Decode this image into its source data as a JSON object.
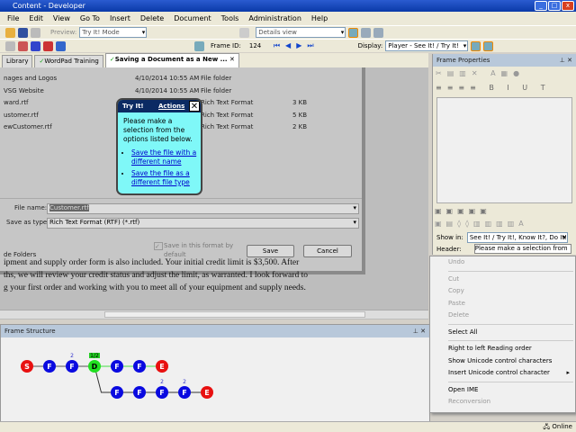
{
  "window": {
    "title": "Content - Developer"
  },
  "menu": [
    "File",
    "Edit",
    "View",
    "Go To",
    "Insert",
    "Delete",
    "Document",
    "Tools",
    "Administration",
    "Help"
  ],
  "toolbar": {
    "preview_label": "Preview:",
    "preview_mode": "Try It! Mode",
    "view_select": "Details view",
    "frame_id_label": "Frame ID:",
    "frame_id": "124",
    "display_label": "Display:",
    "display_value": "Player - See It! / Try It!"
  },
  "tabs": [
    {
      "label": "Library"
    },
    {
      "label": "WordPad Training"
    },
    {
      "label": "Saving a Document as a New ..."
    }
  ],
  "dialog": {
    "files": [
      {
        "name": "nages and Logos",
        "date": "4/10/2014 10:55 AM",
        "type": "File folder",
        "size": ""
      },
      {
        "name": "VSG Website",
        "date": "4/10/2014 10:55 AM",
        "type": "File folder",
        "size": ""
      },
      {
        "name": "ward.rtf",
        "date": "",
        "type": "Rich Text Format",
        "size": "3 KB"
      },
      {
        "name": "ustomer.rtf",
        "date": "",
        "type": "Rich Text Format",
        "size": "5 KB"
      },
      {
        "name": "ewCustomer.rtf",
        "date": "",
        "type": "Rich Text Format",
        "size": "2 KB"
      }
    ],
    "file_name_label": "File name:",
    "file_name": "Customer.rtf",
    "save_type_label": "Save as type:",
    "save_type": "Rich Text Format (RTF) (*.rtf)",
    "checkbox_label": "Save in this format by default",
    "hide_folders": "de Folders",
    "save": "Save",
    "cancel": "Cancel"
  },
  "tryit": {
    "title": "Try It!",
    "actions": "Actions",
    "body": "Please make a selection from the options listed below.",
    "options": [
      "Save the file with a different name",
      "Save the file as a different file type"
    ]
  },
  "doc_text": [
    "ipment and supply order form is also included. Your initial credit limit is $3,500. After",
    "ths, we will review your credit status and adjust the limit, as warranted. I look forward to",
    "g your first order and working with you to meet all of your equipment and supply needs."
  ],
  "frame_structure": {
    "title": "Frame Structure",
    "row1": [
      {
        "l": "S",
        "c": "#e81010"
      },
      {
        "l": "F",
        "c": "#0a0ae0"
      },
      {
        "l": "F",
        "c": "#0a0ae0",
        "badge": "2"
      },
      {
        "l": "D",
        "c": "#20e020",
        "badge": "1/2"
      },
      {
        "l": "F",
        "c": "#0a0ae0"
      },
      {
        "l": "F",
        "c": "#0a0ae0"
      },
      {
        "l": "E",
        "c": "#e81010"
      }
    ],
    "row2": [
      {
        "l": "F",
        "c": "#0a0ae0"
      },
      {
        "l": "F",
        "c": "#0a0ae0"
      },
      {
        "l": "F",
        "c": "#0a0ae0",
        "badge": "2"
      },
      {
        "l": "F",
        "c": "#0a0ae0",
        "badge": "2"
      },
      {
        "l": "E",
        "c": "#e81010"
      }
    ]
  },
  "frame_properties": {
    "title": "Frame Properties",
    "show_in_label": "Show in:",
    "show_in": "See It! / Try It!, Know It?, Do It!",
    "header_label": "Header:",
    "header_value": "Please make a selection from"
  },
  "context_menu": [
    {
      "label": "Undo",
      "disabled": true
    },
    {
      "sep": true
    },
    {
      "label": "Cut",
      "disabled": true
    },
    {
      "label": "Copy",
      "disabled": true
    },
    {
      "label": "Paste",
      "disabled": true
    },
    {
      "label": "Delete",
      "disabled": true
    },
    {
      "sep": true
    },
    {
      "label": "Select All"
    },
    {
      "sep": true
    },
    {
      "label": "Right to left Reading order"
    },
    {
      "label": "Show Unicode control characters"
    },
    {
      "label": "Insert Unicode control character",
      "submenu": true
    },
    {
      "sep": true
    },
    {
      "label": "Open IME"
    },
    {
      "label": "Reconversion",
      "disabled": true
    }
  ],
  "status": {
    "text": "Online"
  }
}
